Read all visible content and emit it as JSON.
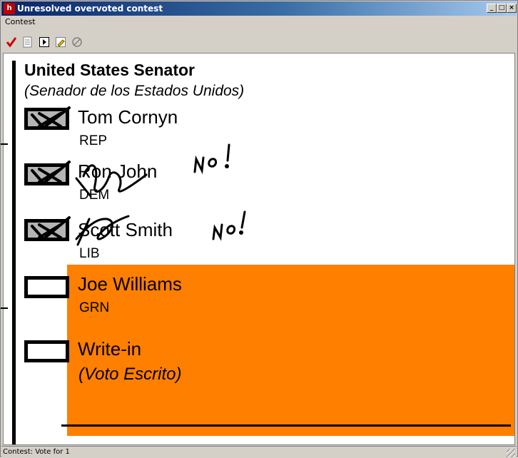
{
  "window": {
    "title": "Unresolved overvoted contest",
    "app_icon_label": "h",
    "controls": {
      "minimize": "_",
      "maximize": "□",
      "close": "×"
    }
  },
  "menu": {
    "items": [
      "Contest"
    ]
  },
  "toolbar": {
    "buttons": [
      {
        "name": "accept-check-icon",
        "color": "#cc0000"
      },
      {
        "name": "ballot-view-icon"
      },
      {
        "name": "next-frame-icon"
      },
      {
        "name": "highlight-pencil-icon"
      },
      {
        "name": "no-vote-icon"
      }
    ]
  },
  "ballot": {
    "contest_title": "United States Senator",
    "contest_subtitle": "(Senador de los Estados Unidos)",
    "candidates": [
      {
        "name": "Tom Cornyn",
        "party": "REP",
        "marked": true
      },
      {
        "name": "Ron John",
        "party": "DEM",
        "marked": true
      },
      {
        "name": "Scott Smith",
        "party": "LIB",
        "marked": true
      },
      {
        "name": "Joe Williams",
        "party": "GRN",
        "marked": false
      },
      {
        "name": "Write-in",
        "subtitle": "(Voto Escrito)",
        "marked": false
      }
    ],
    "handwritten_notes": [
      "NO!",
      "NO!"
    ],
    "highlight_color": "#ff7f00"
  },
  "status": {
    "text": "Contest: Vote for 1"
  }
}
